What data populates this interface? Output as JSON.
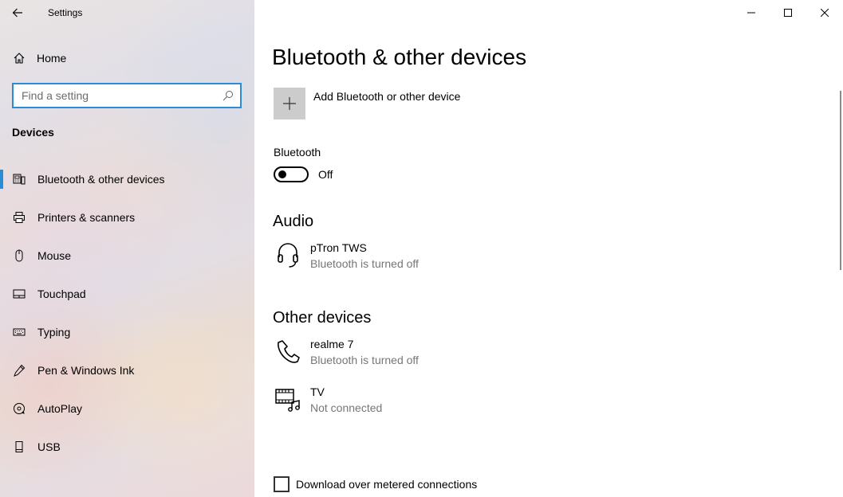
{
  "window": {
    "app_title": "Settings",
    "controls": [
      "minimize",
      "maximize",
      "close"
    ]
  },
  "sidebar": {
    "home_label": "Home",
    "search": {
      "placeholder": "Find a setting",
      "value": ""
    },
    "section_title": "Devices",
    "items": [
      {
        "label": "Bluetooth & other devices",
        "icon": "bluetooth-devices-icon",
        "active": true
      },
      {
        "label": "Printers & scanners",
        "icon": "printer-icon",
        "active": false
      },
      {
        "label": "Mouse",
        "icon": "mouse-icon",
        "active": false
      },
      {
        "label": "Touchpad",
        "icon": "touchpad-icon",
        "active": false
      },
      {
        "label": "Typing",
        "icon": "keyboard-icon",
        "active": false
      },
      {
        "label": "Pen & Windows Ink",
        "icon": "pen-icon",
        "active": false
      },
      {
        "label": "AutoPlay",
        "icon": "autoplay-icon",
        "active": false
      },
      {
        "label": "USB",
        "icon": "usb-icon",
        "active": false
      }
    ]
  },
  "main": {
    "title": "Bluetooth & other devices",
    "add_device_label": "Add Bluetooth or other device",
    "bluetooth": {
      "label": "Bluetooth",
      "state": "Off",
      "on": false
    },
    "audio": {
      "title": "Audio",
      "devices": [
        {
          "name": "pTron TWS",
          "status": "Bluetooth is turned off",
          "icon": "headset-icon"
        }
      ]
    },
    "other": {
      "title": "Other devices",
      "devices": [
        {
          "name": "realme 7",
          "status": "Bluetooth is turned off",
          "icon": "phone-icon"
        },
        {
          "name": "TV",
          "status": "Not connected",
          "icon": "media-device-icon"
        }
      ]
    },
    "metered": {
      "label": "Download over metered connections",
      "checked": false
    }
  },
  "colors": {
    "accent": "#2a8bd6",
    "secondary_text": "#767676",
    "add_tile": "#cccccc"
  }
}
